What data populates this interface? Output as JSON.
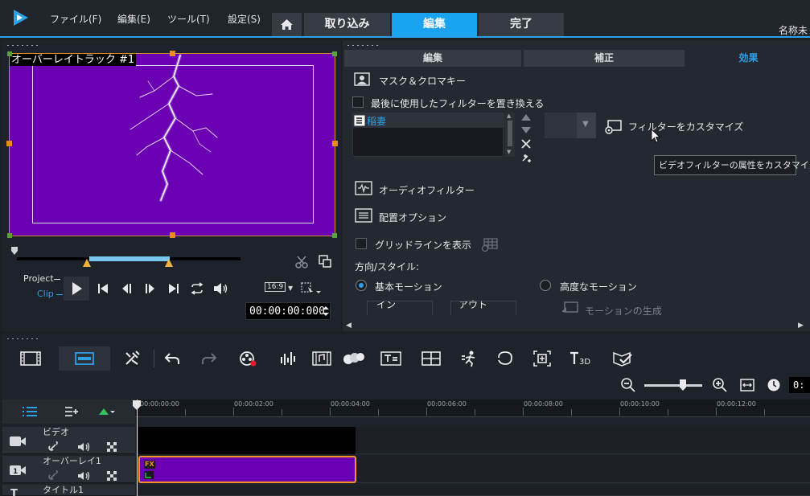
{
  "menu": {
    "file": "ファイル(F)",
    "edit": "編集(E)",
    "tools": "ツール(T)",
    "settings": "設定(S)"
  },
  "tabs": {
    "capture": "取り込み",
    "edit": "編集",
    "share": "完了"
  },
  "project_name": "名称未",
  "preview": {
    "overlay_label": "オーバーレイトラック #1",
    "project_label": "Project",
    "clip_label": "Clip",
    "aspect": "16:9",
    "timecode": "00:00:00:000"
  },
  "options": {
    "tabs": {
      "edit": "編集",
      "correct": "補正",
      "effect": "効果"
    },
    "mask": "マスク＆クロマキー",
    "replace_filter": "最後に使用したフィルターを置き換える",
    "filter_item": "稲妻",
    "customize": "フィルターをカスタマイズ",
    "tooltip": "ビデオフィルターの属性をカスタマイズ",
    "audio_filter": "オーディオフィルター",
    "placement": "配置オプション",
    "gridlines": "グリッドラインを表示",
    "direction": "方向/スタイル:",
    "basic_motion": "基本モーション",
    "advanced_motion": "高度なモーション",
    "in": "イン",
    "out": "アウト",
    "generate_motion": "モーションの生成"
  },
  "timeline": {
    "ruler": [
      "00:00:00:00",
      "00:00:02:00",
      "00:00:04:00",
      "00:00:06:00",
      "00:00:08:00",
      "00:00:10:00",
      "00:00:12:00"
    ],
    "zoom_time": "0:",
    "tracks": {
      "video": "ビデオ",
      "overlay": "オーバーレイ1",
      "title": "タイトル1"
    },
    "fx_badge": "FX"
  },
  "colors": {
    "accent": "#1aa3ee",
    "clip": "#6a00b2",
    "clip_border": "#f19422"
  }
}
